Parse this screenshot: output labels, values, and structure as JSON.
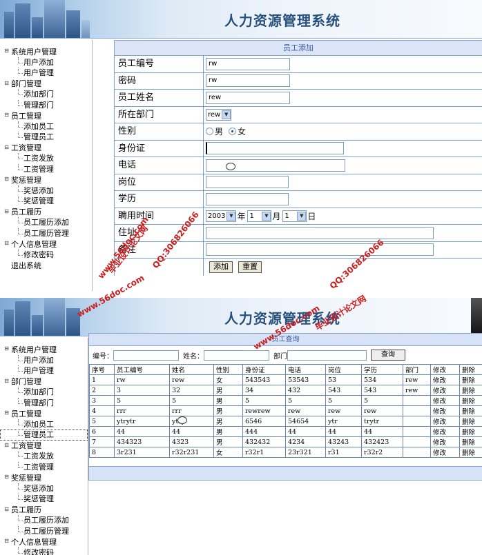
{
  "app_title": "人力资源管理系统",
  "sidebar": {
    "groups": [
      {
        "label": "系统用户管理",
        "items": [
          "用户添加",
          "用户管理"
        ]
      },
      {
        "label": "部门管理",
        "items": [
          "添加部门",
          "管理部门"
        ]
      },
      {
        "label": "员工管理",
        "items": [
          "添加员工",
          "管理员工"
        ]
      },
      {
        "label": "工资管理",
        "items": [
          "工资发放",
          "工资管理"
        ]
      },
      {
        "label": "奖惩管理",
        "items": [
          "奖惩添加",
          "奖惩管理"
        ]
      },
      {
        "label": "员工履历",
        "items": [
          "员工履历添加",
          "员工履历管理"
        ]
      },
      {
        "label": "个人信息管理",
        "items": [
          "修改密码"
        ]
      }
    ],
    "logout": "退出系统"
  },
  "form": {
    "title": "员工添加",
    "fields": {
      "emp_no": {
        "label": "员工编号",
        "value": "rw"
      },
      "password": {
        "label": "密码",
        "value": "rw"
      },
      "emp_name": {
        "label": "员工姓名",
        "value": "rew"
      },
      "dept": {
        "label": "所在部门",
        "value": "rew"
      },
      "gender": {
        "label": "性别",
        "male": "男",
        "female": "女",
        "selected": "女"
      },
      "id_card": {
        "label": "身份证",
        "value": ""
      },
      "phone": {
        "label": "电话",
        "value": ""
      },
      "position": {
        "label": "岗位",
        "value": ""
      },
      "education": {
        "label": "学历",
        "value": ""
      },
      "hire_time": {
        "label": "聘用时间",
        "year": "2003",
        "year_unit": "年",
        "month": "1",
        "month_unit": "月",
        "day": "1",
        "day_unit": "日"
      },
      "address": {
        "label": "住址",
        "value": ""
      },
      "remark": {
        "label": "备注",
        "value": ""
      }
    },
    "buttons": {
      "add": "添加",
      "reset": "重置"
    }
  },
  "query": {
    "title": "员工查询",
    "emp_no_label": "编号：",
    "name_label": "姓名：",
    "dept_label": "部门",
    "search_button": "查询"
  },
  "table": {
    "headers": [
      "序号",
      "员工编号",
      "姓名",
      "性别",
      "身份证",
      "电话",
      "岗位",
      "学历",
      "部门",
      "修改",
      "删除"
    ],
    "rows": [
      [
        "1",
        "rw",
        "rew",
        "女",
        "543543",
        "53543",
        "53",
        "534",
        "rew",
        "修改",
        "删除"
      ],
      [
        "2",
        "3",
        "32",
        "男",
        "34",
        "432",
        "543",
        "543",
        "rew",
        "修改",
        "删除"
      ],
      [
        "3",
        "5",
        "5",
        "男",
        "5",
        "5",
        "5",
        "5",
        "",
        "修改",
        "删除"
      ],
      [
        "4",
        "rrr",
        "rrr",
        "男",
        "rewrew",
        "rew",
        "rew",
        "rew",
        "",
        "修改",
        "删除"
      ],
      [
        "5",
        "ytrytr",
        "ytry",
        "男",
        "6546",
        "54654",
        "ytr",
        "trytr",
        "",
        "修改",
        "删除"
      ],
      [
        "6",
        "44",
        "44",
        "男",
        "444",
        "44",
        "44",
        "44",
        "",
        "修改",
        "删除"
      ],
      [
        "7",
        "434323",
        "4323",
        "男",
        "432432",
        "4234",
        "43243",
        "432423",
        "",
        "修改",
        "删除"
      ],
      [
        "8",
        "3r231",
        "r32r231",
        "女",
        "r32r1",
        "23r321",
        "r31",
        "r32r2",
        "",
        "修改",
        "删除"
      ]
    ]
  },
  "watermark": {
    "site": "www.56doc.com",
    "qq": "QQ:306826066",
    "tag": "毕业设计论文网"
  },
  "colors": {
    "accent": "#3a5ba0",
    "panel_header": "#dbe5f7",
    "border": "#7f9fcf",
    "watermark": "#cc1d1d"
  }
}
